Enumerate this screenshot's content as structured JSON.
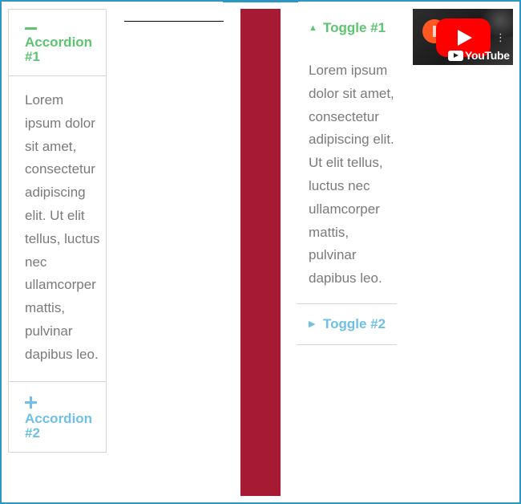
{
  "accordion": {
    "items": [
      {
        "title": "Accordion #1",
        "icon": "minus-icon",
        "expanded": true,
        "content": "Lorem ipsum dolor sit amet, consectetur adipiscing elit. Ut elit tellus, luctus nec ullamcorper mattis, pulvinar dapibus leo."
      },
      {
        "title": "Accordion #2",
        "icon": "plus-icon",
        "expanded": false
      }
    ]
  },
  "toggle": {
    "items": [
      {
        "title": "Toggle #1",
        "icon": "caret-up-icon",
        "expanded": true,
        "content": "Lorem ipsum dolor sit amet, consectetur adipiscing elit. Ut elit tellus, luctus nec ullamcorper mattis, pulvinar dapibus leo."
      },
      {
        "title": "Toggle #2",
        "icon": "caret-right-icon",
        "expanded": false
      }
    ]
  },
  "video": {
    "logo_text": "YouTube",
    "menu_glyph": "⋮"
  },
  "colors": {
    "frame_border": "#2a98c2",
    "active_title": "#5dc56f",
    "inactive_title": "#6ec1e4",
    "body_text": "#7a7a7a",
    "red_block": "#a61a33",
    "play_button": "#ff0000"
  }
}
